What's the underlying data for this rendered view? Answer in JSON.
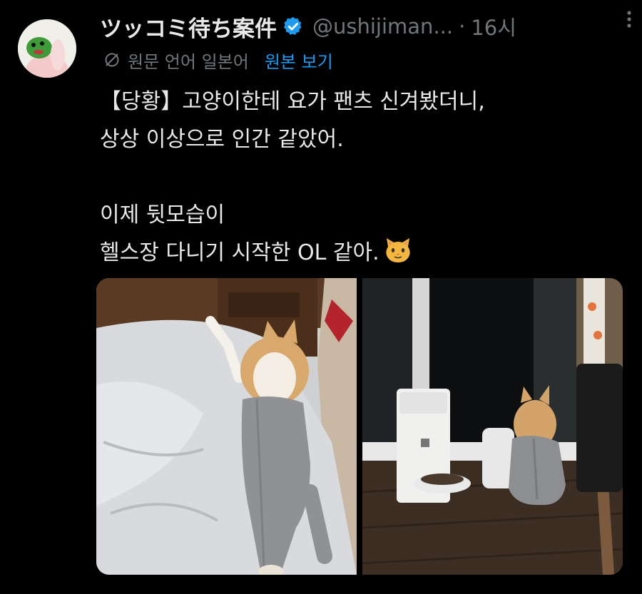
{
  "author": {
    "display_name": "ツッコミ待ち案件",
    "handle": "@ushijiman...",
    "separator": "·",
    "time": "16시"
  },
  "icons": {
    "verified": "verified-badge-icon",
    "more": "more-options-icon",
    "translate": "translate-globe-icon",
    "cat": "cat-face-emoji"
  },
  "translation": {
    "source_label": "원문 언어 일본어",
    "view_original": "원본 보기"
  },
  "tweet": {
    "line1": "【당황】고양이한테 요가 팬츠 신겨봤더니,",
    "line2": "상상 이상으로 인간 같았어.",
    "line3": "이제 뒷모습이",
    "line4": "헬스장 다니기 시작한 OL 같아."
  },
  "colors": {
    "background": "#000000",
    "text": "#e7e9ea",
    "secondary": "#71767b",
    "link": "#1d9bf0"
  }
}
